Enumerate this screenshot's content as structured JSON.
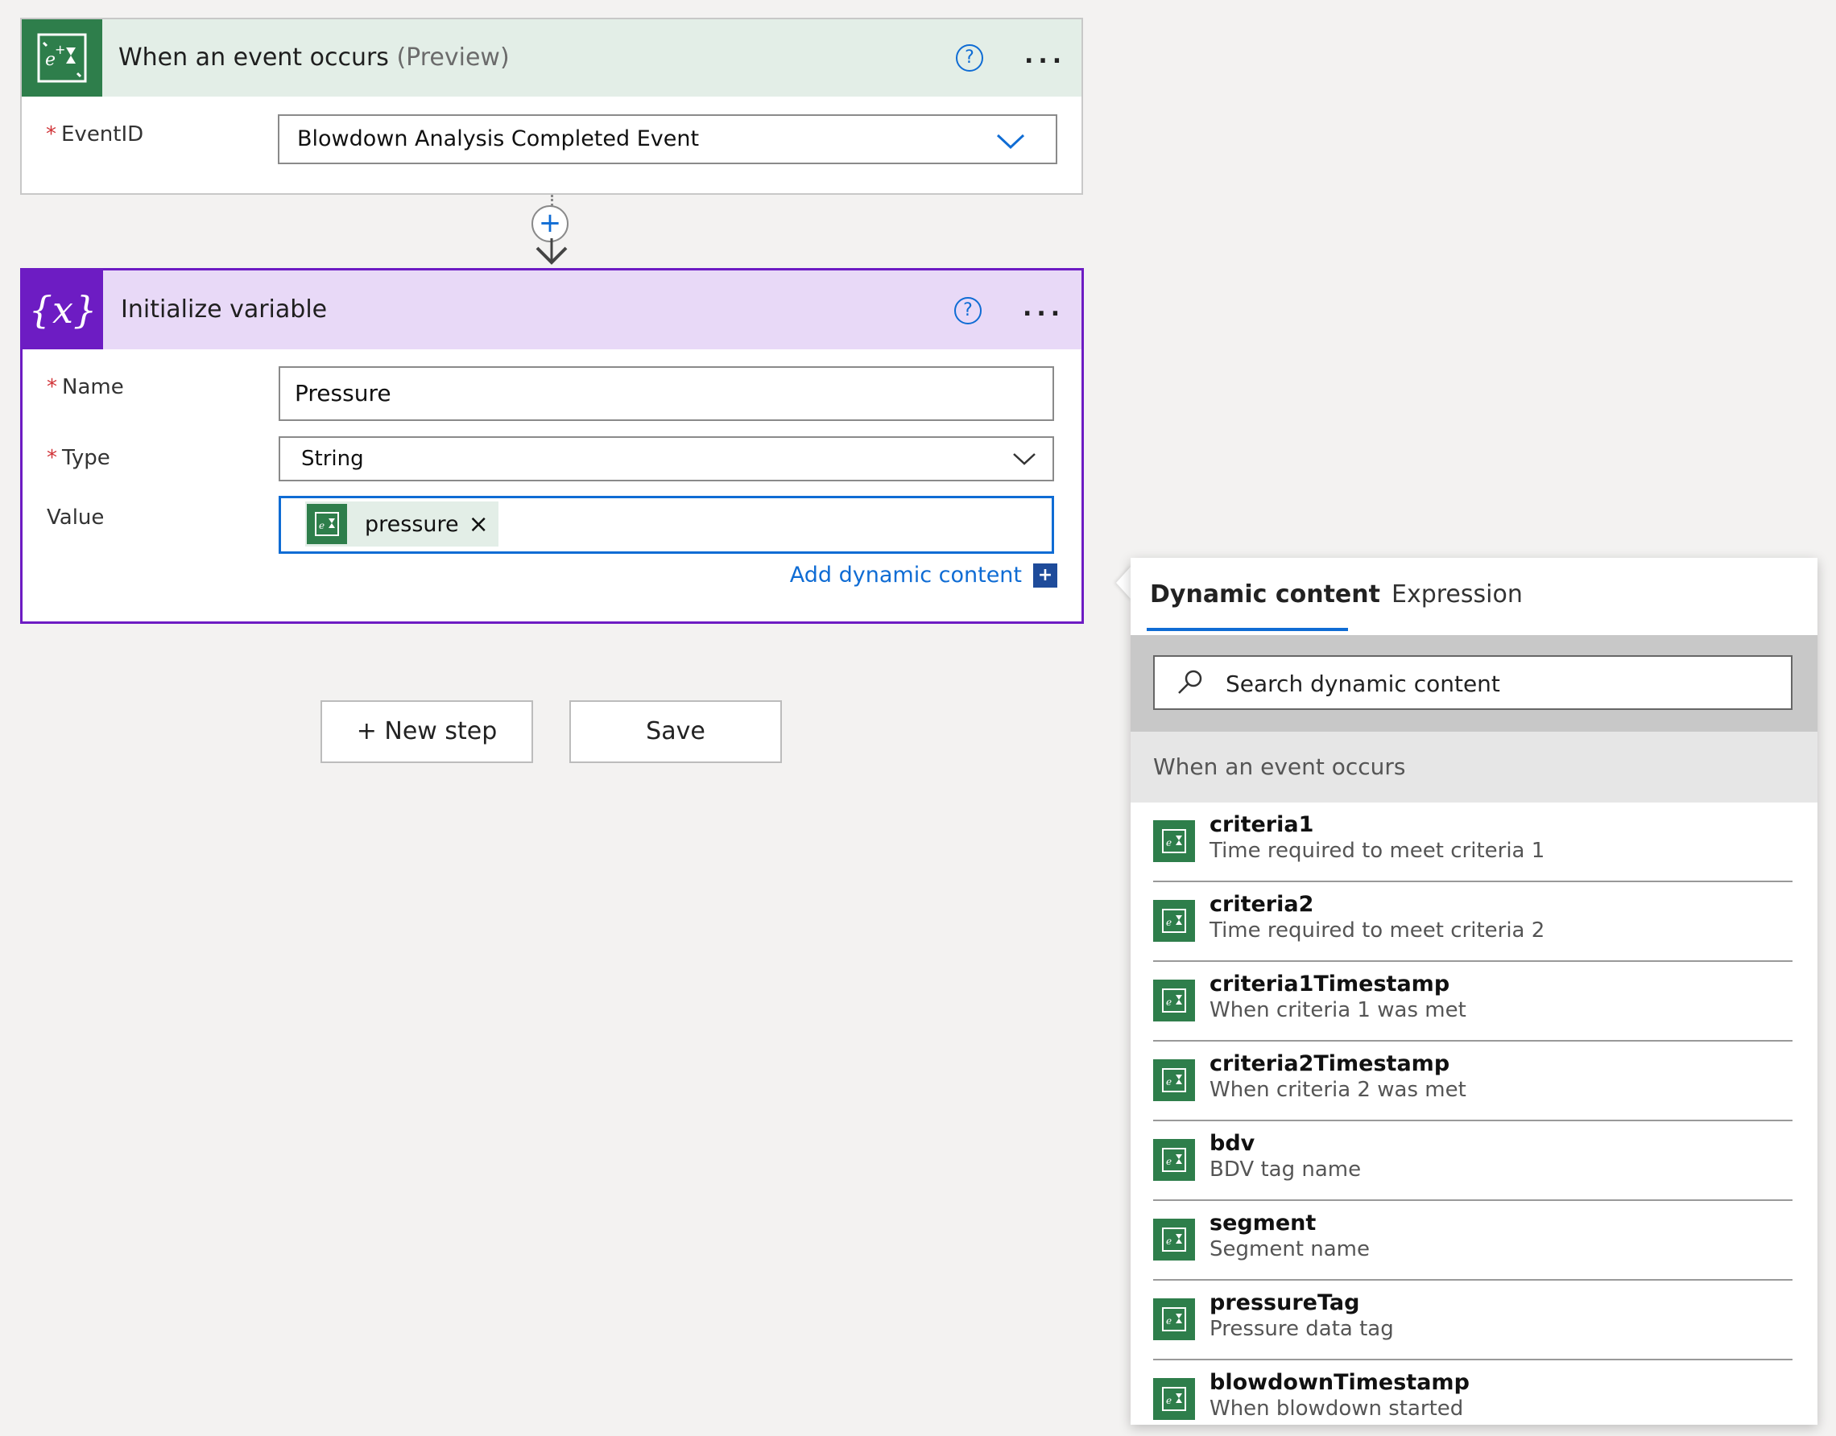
{
  "trigger": {
    "title": "When an event occurs",
    "title_suffix": "(Preview)",
    "help_icon": "help-icon",
    "more_label": "...",
    "fields": {
      "eventid_label": "EventID",
      "eventid_value": "Blowdown Analysis Completed Event"
    },
    "header_color": "#e3eee7",
    "icon_color": "#2e7e4b"
  },
  "connector": {
    "add_label": "+"
  },
  "init_variable": {
    "title": "Initialize variable",
    "icon_text": "{x}",
    "more_label": "...",
    "name_label": "Name",
    "name_value": "Pressure",
    "type_label": "Type",
    "type_value": "String",
    "value_label": "Value",
    "token_label": "pressure",
    "token_remove": "×",
    "add_dynamic_label": "Add dynamic content",
    "add_dynamic_icon": "+",
    "accent_color": "#6d1cc3",
    "header_color": "#e8d9f7"
  },
  "actions": {
    "new_step_label": "+ New step",
    "save_label": "Save"
  },
  "dynamic_panel": {
    "tabs": [
      "Dynamic content",
      "Expression"
    ],
    "active_tab": "Dynamic content",
    "search_placeholder": "Search dynamic content",
    "group_title": "When an event occurs",
    "items": [
      {
        "name": "criteria1",
        "description": "Time required to meet criteria 1"
      },
      {
        "name": "criteria2",
        "description": "Time required to meet criteria 2"
      },
      {
        "name": "criteria1Timestamp",
        "description": "When criteria 1 was met"
      },
      {
        "name": "criteria2Timestamp",
        "description": "When criteria 2 was met"
      },
      {
        "name": "bdv",
        "description": "BDV tag name"
      },
      {
        "name": "segment",
        "description": "Segment name"
      },
      {
        "name": "pressureTag",
        "description": "Pressure data tag"
      },
      {
        "name": "blowdownTimestamp",
        "description": "When blowdown started"
      }
    ],
    "accent_color": "#0f6cd4"
  }
}
